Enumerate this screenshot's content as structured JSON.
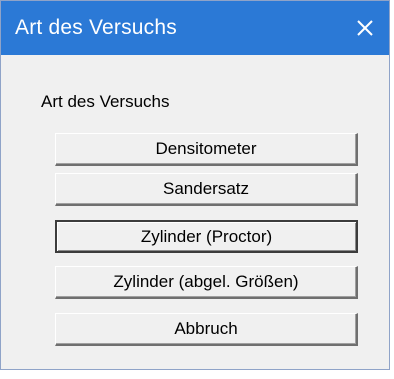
{
  "window": {
    "title": "Art des Versuchs"
  },
  "dialog": {
    "group_label": "Art des Versuchs",
    "buttons": [
      {
        "label": "Densitometer"
      },
      {
        "label": "Sandersatz"
      },
      {
        "label": "Zylinder (Proctor)"
      },
      {
        "label": "Zylinder (abgel. Größen)"
      },
      {
        "label": "Abbruch"
      }
    ]
  },
  "icons": {
    "close": "close-icon"
  },
  "colors": {
    "titlebar": "#2b79d6",
    "title_text": "#ffffff",
    "dialog_bg": "#f0f0f0"
  }
}
